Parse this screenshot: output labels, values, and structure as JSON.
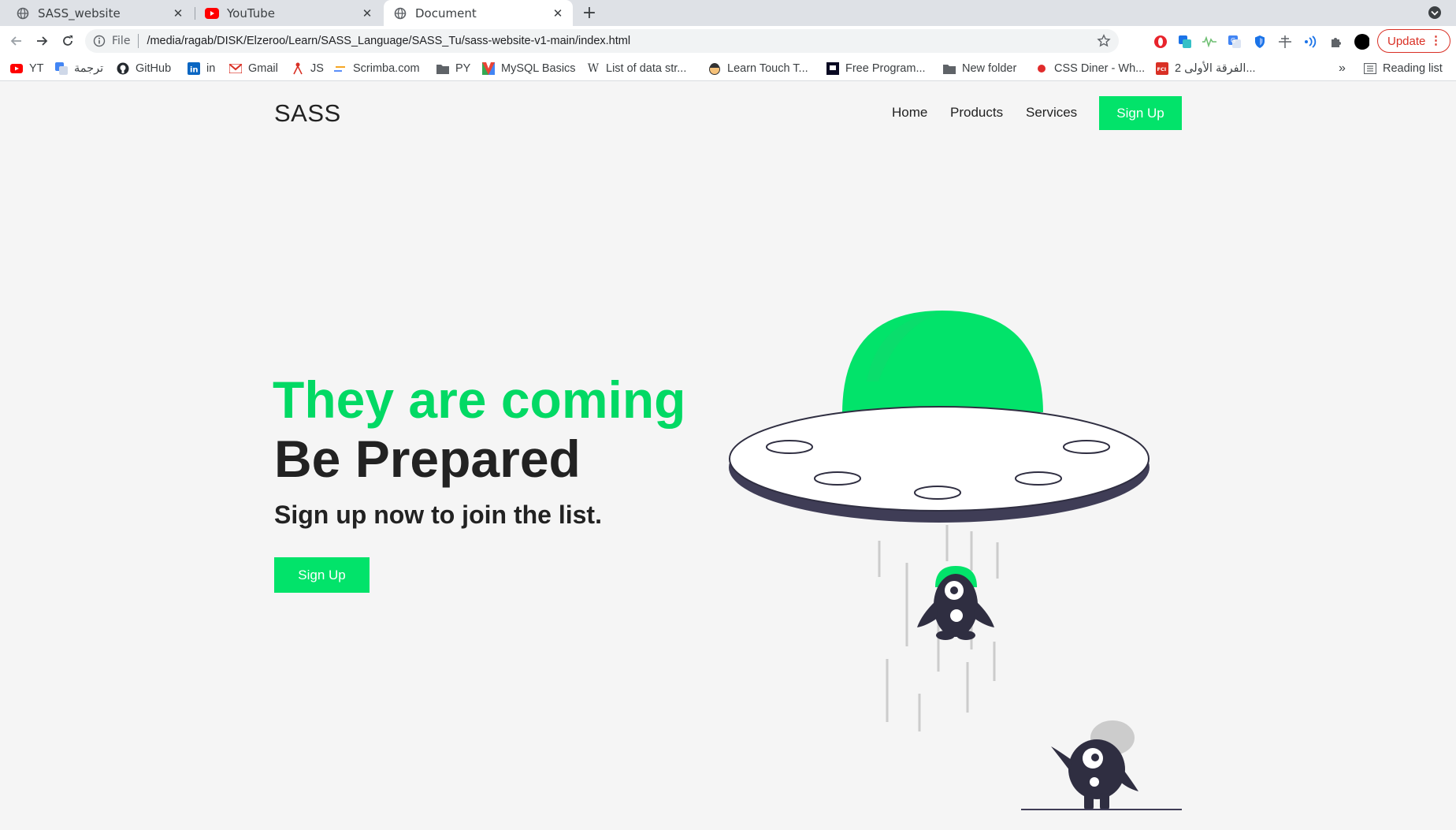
{
  "browser": {
    "tabs": [
      {
        "title": "SASS_website",
        "favicon": "globe-icon"
      },
      {
        "title": "YouTube",
        "favicon": "youtube-icon"
      },
      {
        "title": "Document",
        "favicon": "globe-icon",
        "active": true
      }
    ],
    "address": {
      "scheme": "File",
      "url": "/media/ragab/DISK/Elzeroo/Learn/SASS_Language/SASS_Tu/sass-website-v1-main/index.html"
    },
    "update_label": "Update",
    "bookmarks": [
      {
        "label": "YT",
        "icon": "youtube-icon"
      },
      {
        "label": "ترجمة",
        "icon": "translate-icon"
      },
      {
        "label": "GitHub",
        "icon": "github-icon"
      },
      {
        "label": "in",
        "icon": "linkedin-icon"
      },
      {
        "label": "Gmail",
        "icon": "gmail-icon"
      },
      {
        "label": "JS",
        "icon": "js-icon"
      },
      {
        "label": "Scrimba.com",
        "icon": "scrimba-icon"
      },
      {
        "label": "PY",
        "icon": "folder-icon"
      },
      {
        "label": "MySQL Basics",
        "icon": "mysql-icon"
      },
      {
        "label": "List of data str...",
        "icon": "wikipedia-icon"
      },
      {
        "label": "Learn Touch T...",
        "icon": "typing-icon"
      },
      {
        "label": "Free Program...",
        "icon": "freecodecamp-icon"
      },
      {
        "label": "New folder",
        "icon": "folder-icon"
      },
      {
        "label": "CSS Diner - Wh...",
        "icon": "cssdiner-icon"
      },
      {
        "label": "الفرقة الأولى 2...",
        "icon": "fci-icon"
      }
    ],
    "bookmarks_overflow": "»",
    "reading_list": "Reading list"
  },
  "site": {
    "logo": "SASS",
    "nav": {
      "home": "Home",
      "products": "Products",
      "services": "Services",
      "signup": "Sign Up"
    },
    "hero": {
      "headline_green": "They are coming",
      "headline_dark": "Be Prepared",
      "subtitle": "Sign up now to join the list.",
      "cta": "Sign Up"
    }
  },
  "colors": {
    "accent": "#02e36a",
    "dark": "#2f2e41",
    "page_bg": "#f5f5f5"
  }
}
